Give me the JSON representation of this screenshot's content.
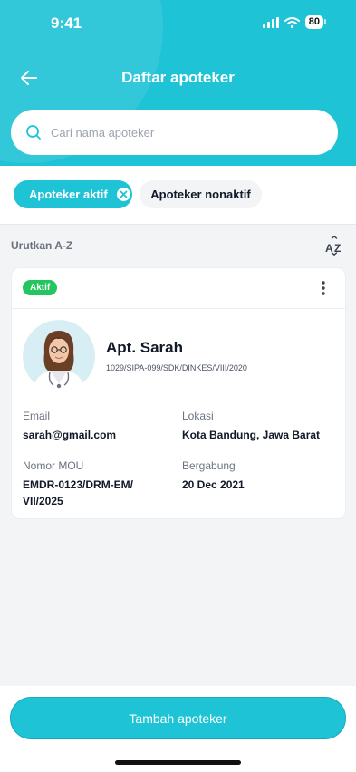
{
  "status_bar": {
    "time": "9:41",
    "battery": "80"
  },
  "header": {
    "title": "Daftar apoteker"
  },
  "search": {
    "placeholder": "Cari nama apoteker"
  },
  "filters": {
    "active_label": "Apoteker aktif",
    "inactive_label": "Apoteker nonaktif"
  },
  "sort": {
    "label": "Urutkan A-Z",
    "icon_text": "AZ"
  },
  "pharmacist": {
    "status": "Aktif",
    "name": "Apt. Sarah",
    "license": "1029/SIPA-099/SDK/DINKES/VIII/2020",
    "email_label": "Email",
    "email": "sarah@gmail.com",
    "location_label": "Lokasi",
    "location": "Kota Bandung, Jawa Barat",
    "mou_label": "Nomor MOU",
    "mou_line1": "EMDR-0123/DRM-EM/",
    "mou_line2": "VII/2025",
    "joined_label": "Bergabung",
    "joined": "20 Dec 2021"
  },
  "actions": {
    "add_label": "Tambah apoteker"
  },
  "colors": {
    "accent": "#1ec3d6",
    "status_active": "#22c55e"
  }
}
